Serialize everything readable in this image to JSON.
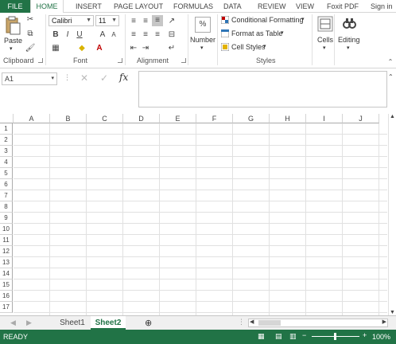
{
  "tabs": [
    "FILE",
    "HOME",
    "INSERT",
    "PAGE LAYOUT",
    "FORMULAS",
    "DATA",
    "REVIEW",
    "VIEW",
    "Foxit PDF",
    "Sign in"
  ],
  "clipboard": {
    "paste_label": "Paste",
    "group_label": "Clipboard"
  },
  "font": {
    "name": "Calibri",
    "size": "11",
    "group_label": "Font",
    "bold": "B",
    "italic": "I",
    "underline": "U"
  },
  "alignment": {
    "group_label": "Alignment"
  },
  "number": {
    "label": "Number",
    "percent_icon": "%"
  },
  "styles": {
    "conditional": "Conditional Formatting",
    "format_table": "Format as Table",
    "cell_styles": "Cell Styles",
    "group_label": "Styles"
  },
  "cells": {
    "label": "Cells"
  },
  "editing": {
    "label": "Editing"
  },
  "formula_bar": {
    "name_box": "A1",
    "fx": "fx"
  },
  "columns": [
    "A",
    "B",
    "C",
    "D",
    "E",
    "F",
    "G",
    "H",
    "I",
    "J"
  ],
  "rows": [
    "1",
    "2",
    "3",
    "4",
    "5",
    "6",
    "7",
    "8",
    "9",
    "10",
    "11",
    "12",
    "13",
    "14",
    "15",
    "16",
    "17"
  ],
  "sheets": [
    "Sheet1",
    "Sheet2"
  ],
  "status": {
    "ready": "READY",
    "zoom": "100%"
  },
  "colors": {
    "accent": "#217346"
  }
}
